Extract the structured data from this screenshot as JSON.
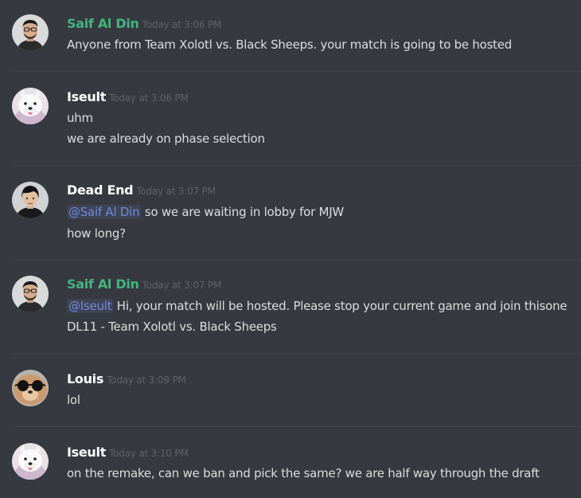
{
  "colors": {
    "background": "#36393f",
    "divider": "#40444b",
    "author_green": "#43b581",
    "author_white": "#ffffff",
    "timestamp": "#5f6268",
    "text": "#dcddde",
    "mention": "#7289da"
  },
  "messages": [
    {
      "author": "Saif Al Din",
      "author_color": "#43b581",
      "avatar": "saif-avatar",
      "timestamp": "Today at 3:06 PM",
      "lines": [
        [
          {
            "text": "Anyone from Team Xolotl vs. Black Sheeps. your match is going to be hosted"
          }
        ]
      ]
    },
    {
      "author": "Iseult",
      "author_color": "#ffffff",
      "avatar": "iseult-avatar",
      "timestamp": "Today at 3:06 PM",
      "lines": [
        [
          {
            "text": "uhm"
          }
        ],
        [
          {
            "text": "we are already on phase selection"
          }
        ]
      ]
    },
    {
      "author": "Dead End",
      "author_color": "#ffffff",
      "avatar": "deadend-avatar",
      "timestamp": "Today at 3:07 PM",
      "lines": [
        [
          {
            "mention": "@Saif Al Din"
          },
          {
            "text": " so we are waiting in lobby for MJW"
          }
        ],
        [
          {
            "text": "how long?"
          }
        ]
      ]
    },
    {
      "author": "Saif Al Din",
      "author_color": "#43b581",
      "avatar": "saif-avatar",
      "timestamp": "Today at 3:07 PM",
      "lines": [
        [
          {
            "mention": "@Iseult"
          },
          {
            "text": " Hi, your match will be hosted. Please stop your current game and join thisone"
          }
        ],
        [
          {
            "text": "DL11 - Team Xolotl vs. Black Sheeps"
          }
        ]
      ]
    },
    {
      "author": "Louis",
      "author_color": "#ffffff",
      "avatar": "louis-avatar",
      "timestamp": "Today at 3:09 PM",
      "lines": [
        [
          {
            "text": "lol"
          }
        ]
      ]
    },
    {
      "author": "Iseult",
      "author_color": "#ffffff",
      "avatar": "iseult-avatar",
      "timestamp": "Today at 3:10 PM",
      "lines": [
        [
          {
            "text": "on the remake, can we ban and pick the same? we are half way through the draft"
          }
        ]
      ]
    }
  ]
}
